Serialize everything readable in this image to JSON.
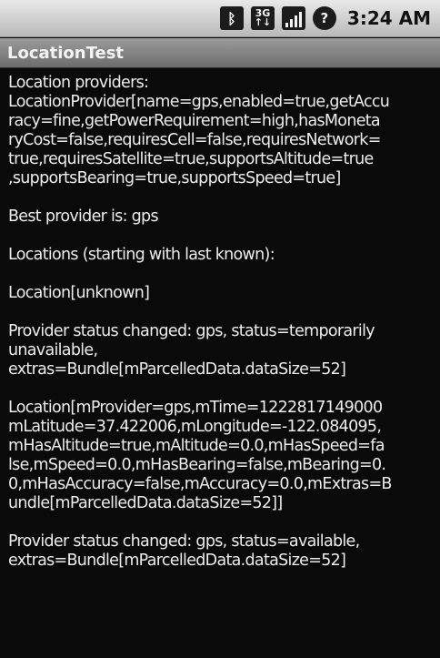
{
  "status_bar": {
    "icons": [
      "bluetooth-icon",
      "3g-icon",
      "signal-icon",
      "help-icon"
    ],
    "time": "3:24 AM",
    "bluetooth_glyph": "ᛒ",
    "network_label_top": "3G",
    "network_label_bottom": "↑↓",
    "help_glyph": "?"
  },
  "title_bar": {
    "title": "LocationTest"
  },
  "content": {
    "paragraphs": [
      {
        "lines": [
          "Location providers:",
          "LocationProvider[name=gps,enabled=true,getAccu",
          "racy=fine,getPowerRequirement=high,hasMoneta",
          "ryCost=false,requiresCell=false,requiresNetwork=",
          "true,requiresSatellite=true,supportsAltitude=true",
          ",supportsBearing=true,supportsSpeed=true]"
        ]
      },
      {
        "lines": [
          "Best provider is: gps"
        ]
      },
      {
        "lines": [
          "Locations (starting with last known):"
        ]
      },
      {
        "lines": [
          "Location[unknown]"
        ]
      },
      {
        "lines": [
          "Provider status changed: gps, status=temporarily",
          "unavailable,",
          "extras=Bundle[mParcelledData.dataSize=52]"
        ]
      },
      {
        "lines": [
          "Location[mProvider=gps,mTime=1222817149000",
          "mLatitude=37.422006,mLongitude=-122.084095,",
          "mHasAltitude=true,mAltitude=0.0,mHasSpeed=fa",
          "lse,mSpeed=0.0,mHasBearing=false,mBearing=0.",
          "0,mHasAccuracy=false,mAccuracy=0.0,mExtras=B",
          "undle[mParcelledData.dataSize=52]]"
        ]
      },
      {
        "lines": [
          "Provider status changed: gps, status=available,",
          "extras=Bundle[mParcelledData.dataSize=52]"
        ]
      }
    ]
  }
}
